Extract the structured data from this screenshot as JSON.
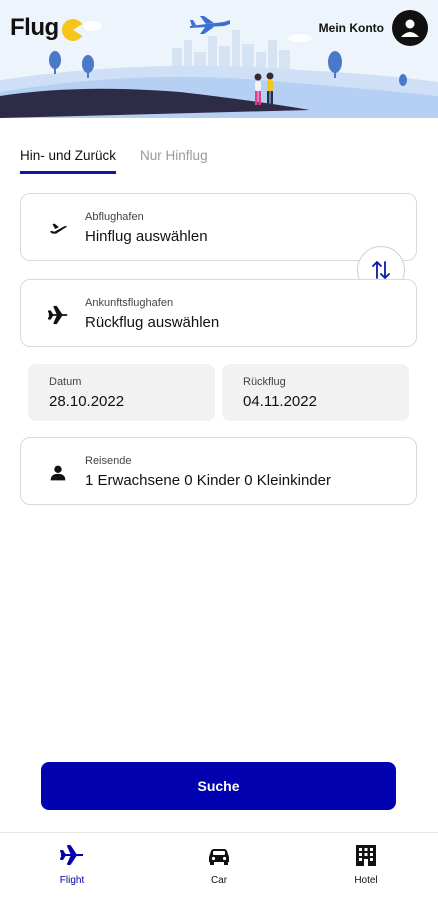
{
  "app": {
    "logo_text": "Flug"
  },
  "header": {
    "account_label": "Mein Konto"
  },
  "tabs": [
    {
      "label": "Hin- und Zurück",
      "active": true
    },
    {
      "label": "Nur Hinflug",
      "active": false
    }
  ],
  "departure": {
    "label": "Abflughafen",
    "value": "Hinflug auswählen",
    "icon": "plane-takeoff-icon"
  },
  "arrival": {
    "label": "Ankunftsflughafen",
    "value": "Rückflug auswählen",
    "icon": "plane-icon"
  },
  "dates": {
    "depart_label": "Datum",
    "depart_value": "28.10.2022",
    "return_label": "Rückflug",
    "return_value": "04.11.2022"
  },
  "travelers": {
    "label": "Reisende",
    "value": "1 Erwachsene 0 Kinder 0 Kleinkinder",
    "icon": "person-icon"
  },
  "search_button": {
    "label": "Suche"
  },
  "bottom_nav": [
    {
      "label": "Flight",
      "icon": "plane-icon",
      "active": true
    },
    {
      "label": "Car",
      "icon": "car-icon",
      "active": false
    },
    {
      "label": "Hotel",
      "icon": "hotel-icon",
      "active": false
    }
  ],
  "colors": {
    "primary": "#0202b0",
    "tab_underline": "#0b1aa8",
    "header_bg": "#eef4fb",
    "logo_accent": "#f5c518"
  }
}
